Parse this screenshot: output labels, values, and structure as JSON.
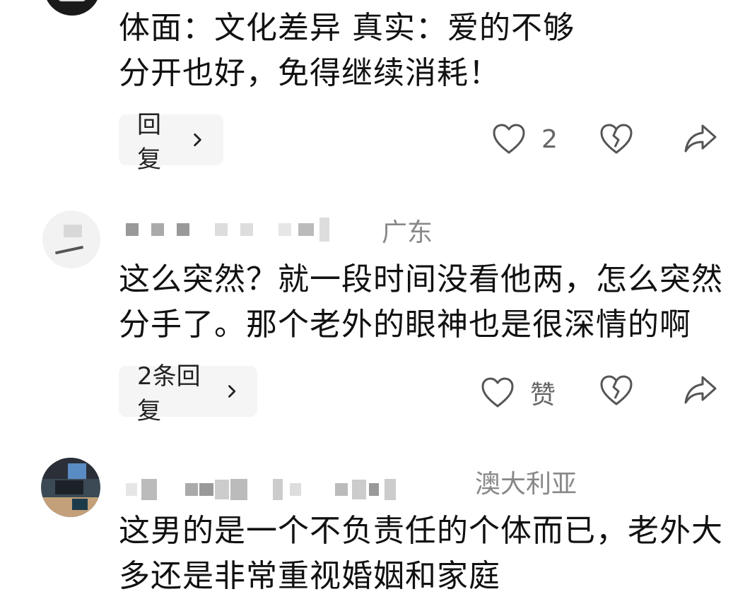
{
  "comments": [
    {
      "text": "体面：文化差异 真实：爱的不够\n分开也好，免得继续消耗！",
      "reply_label": "回复",
      "like_label": "2"
    },
    {
      "location": "广东",
      "text": "这么突然？就一段时间没看他两，怎么突然\n分手了。那个老外的眼神也是很深情的啊",
      "reply_label": "2条回复",
      "like_label": "赞"
    },
    {
      "location": "澳大利亚",
      "text": "这男的是一个不负责任的个体而已，老外大\n多还是非常重视婚姻和家庭"
    }
  ],
  "icons": {
    "like": "heart-icon",
    "dislike": "broken-heart-icon",
    "share": "share-arrow-icon",
    "reply_chevron": "chevron-right-icon"
  },
  "colors": {
    "text": "#111111",
    "meta": "#888888",
    "reply_bg": "#f5f5f5",
    "icon": "#555555"
  }
}
